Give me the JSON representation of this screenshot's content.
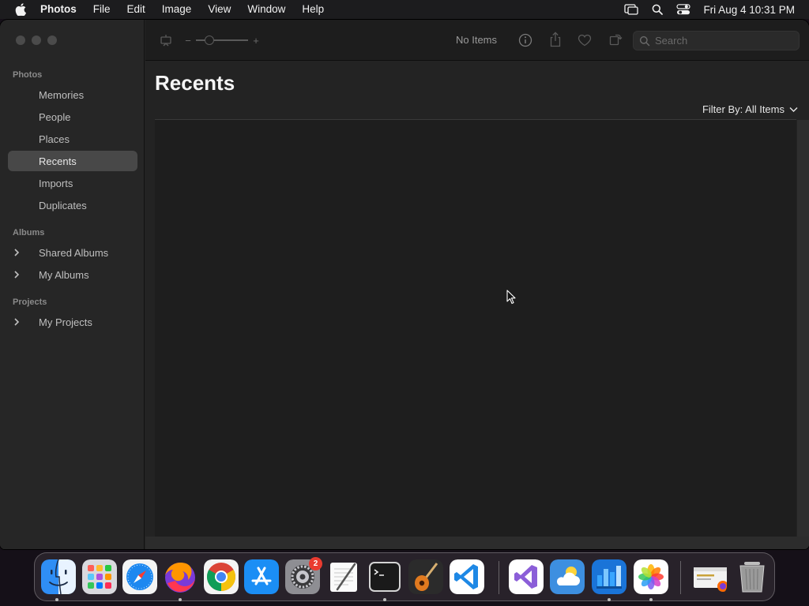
{
  "menubar": {
    "app_name": "Photos",
    "items": [
      "File",
      "Edit",
      "Image",
      "View",
      "Window",
      "Help"
    ],
    "clock": "Fri Aug 4  10:31 PM",
    "icons": [
      "screen-mirroring-icon",
      "spotlight-search-icon",
      "control-center-icon"
    ]
  },
  "sidebar": {
    "sections": [
      {
        "header": "Photos",
        "items": [
          "Memories",
          "People",
          "Places",
          "Recents",
          "Imports",
          "Duplicates"
        ]
      },
      {
        "header": "Albums",
        "items": [
          "Shared Albums",
          "My Albums"
        ]
      },
      {
        "header": "Projects",
        "items": [
          "My Projects"
        ]
      }
    ],
    "selected": "Recents"
  },
  "toolbar": {
    "status": "No Items",
    "search_placeholder": "Search",
    "zoom_minus": "−",
    "zoom_plus": "+",
    "zoom_level": 0.2,
    "icons": [
      "slideshow-icon",
      "info-icon",
      "share-icon",
      "favorite-heart-icon",
      "rotate-icon",
      "search-icon"
    ]
  },
  "content": {
    "title": "Recents",
    "filter_label": "Filter By: All Items"
  },
  "dock": {
    "apps": [
      "Finder",
      "Launchpad",
      "Safari",
      "Firefox",
      "Google Chrome",
      "App Store",
      "System Settings",
      "TextEdit",
      "Terminal",
      "GarageBand",
      "Visual Studio Code",
      "Visual Studio",
      "Weather",
      "Keynote",
      "Photos",
      "Downloads",
      "Trash"
    ],
    "settings_badge": "2"
  },
  "colors": {
    "window_bg": "#232323",
    "sidebar_bg": "#262626",
    "selected_row": "#484848",
    "badge_red": "#ea3b30"
  }
}
